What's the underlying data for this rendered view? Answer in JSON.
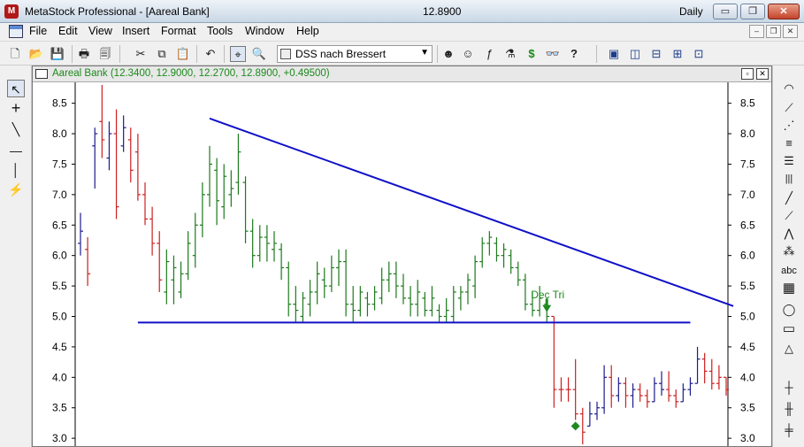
{
  "window": {
    "title": "MetaStock Professional - [Aareal Bank]",
    "last_price": "12.8900",
    "periodicity": "Daily",
    "min_glyph": "▭",
    "max_glyph": "❐",
    "close_glyph": "✕"
  },
  "menu": {
    "items": [
      "File",
      "Edit",
      "View",
      "Insert",
      "Format",
      "Tools",
      "Window",
      "Help"
    ],
    "mdi_min": "–",
    "mdi_restore": "❐",
    "mdi_close": "✕"
  },
  "toolbar": {
    "template_value": "DSS nach Bressert",
    "icons": [
      {
        "name": "new-icon",
        "glyph": "🗋"
      },
      {
        "name": "open-icon",
        "glyph": "📂"
      },
      {
        "name": "save-icon",
        "glyph": "💾"
      },
      {
        "name": "print-icon",
        "glyph": "🖶"
      },
      {
        "name": "print-preview-icon",
        "glyph": "🗐"
      },
      {
        "name": "cut-icon",
        "glyph": "✂"
      },
      {
        "name": "copy-icon",
        "glyph": "⧉"
      },
      {
        "name": "paste-icon",
        "glyph": "📋"
      },
      {
        "name": "undo-icon",
        "glyph": "↶"
      },
      {
        "name": "crosshair-icon",
        "glyph": "⌖"
      },
      {
        "name": "zoom-icon",
        "glyph": "🔍"
      },
      {
        "name": "expert-advisor-icon",
        "glyph": "☻"
      },
      {
        "name": "explorer-icon",
        "glyph": "☺"
      },
      {
        "name": "indicator-builder-icon",
        "glyph": "ƒ"
      },
      {
        "name": "system-tester-icon",
        "glyph": "⚗"
      },
      {
        "name": "dollar-icon",
        "glyph": "$"
      },
      {
        "name": "binoculars-icon",
        "glyph": "👓"
      },
      {
        "name": "help-pointer-icon",
        "glyph": "?"
      },
      {
        "name": "cascade-icon",
        "glyph": "▣"
      },
      {
        "name": "tile-vertical-icon",
        "glyph": "◫"
      },
      {
        "name": "tile-horizontal-icon",
        "glyph": "⊟"
      },
      {
        "name": "tile-grid-icon",
        "glyph": "⊞"
      },
      {
        "name": "arrange-icon",
        "glyph": "⊡"
      }
    ]
  },
  "left_tools": [
    {
      "name": "pointer-tool-icon",
      "glyph": "↖"
    },
    {
      "name": "crosshair-tool-icon",
      "glyph": "+"
    },
    {
      "name": "trendline-tool-icon",
      "glyph": "╲"
    },
    {
      "name": "horizontal-line-tool-icon",
      "glyph": "—"
    },
    {
      "name": "vertical-line-tool-icon",
      "glyph": "│"
    },
    {
      "name": "cycle-line-tool-icon",
      "glyph": "⚡"
    }
  ],
  "right_tools": [
    {
      "name": "arc-tool-icon",
      "glyph": "◠"
    },
    {
      "name": "fan-tool-icon",
      "glyph": "⟋"
    },
    {
      "name": "speed-lines-tool-icon",
      "glyph": "⋰"
    },
    {
      "name": "retracement-tool-icon",
      "glyph": "≡"
    },
    {
      "name": "fib-levels-tool-icon",
      "glyph": "☰"
    },
    {
      "name": "time-zones-tool-icon",
      "glyph": "|||"
    },
    {
      "name": "line-tool-icon",
      "glyph": "╱"
    },
    {
      "name": "gann-fan-tool-icon",
      "glyph": "⟋"
    },
    {
      "name": "andrews-tool-icon",
      "glyph": "⋀"
    },
    {
      "name": "pattern-tool-icon",
      "glyph": "⁂"
    },
    {
      "name": "text-tool-icon",
      "glyph": "abc"
    },
    {
      "name": "grid-tool-icon",
      "glyph": "▦"
    },
    {
      "name": "ellipse-tool-icon",
      "glyph": "◯"
    },
    {
      "name": "rectangle-tool-icon",
      "glyph": "▭"
    },
    {
      "name": "triangle-tool-icon",
      "glyph": "△"
    },
    {
      "name": "bars-tool-icon",
      "glyph": "┼"
    },
    {
      "name": "bars2-tool-icon",
      "glyph": "╫"
    },
    {
      "name": "bars3-tool-icon",
      "glyph": "╪"
    }
  ],
  "chart": {
    "window_title": "Aareal Bank (12.3400, 12.9000, 12.2700, 12.8900, +0.49500)",
    "minimize_glyph": "▫",
    "close_glyph": "✕",
    "colors": {
      "up": "#1c7a1c",
      "down": "#cc1f1f",
      "neutral": "#1c1c8c",
      "trend": "#1010c8",
      "signal": "#1c8a1c"
    }
  },
  "chart_data": {
    "type": "ohlc_bar",
    "ylim": [
      2.9,
      8.8
    ],
    "y_ticks": [
      3.0,
      3.5,
      4.0,
      4.5,
      5.0,
      5.5,
      6.0,
      6.5,
      7.0,
      7.5,
      8.0,
      8.5
    ],
    "grid": false,
    "bars": [
      {
        "h": 6.7,
        "l": 6.0,
        "o": 6.2,
        "c": 6.4,
        "col": "neutral"
      },
      {
        "h": 6.3,
        "l": 5.5,
        "o": 6.1,
        "c": 5.7,
        "col": "down"
      },
      {
        "h": 8.1,
        "l": 7.1,
        "o": 7.8,
        "c": 8.0,
        "col": "neutral"
      },
      {
        "h": 8.8,
        "l": 7.6,
        "o": 8.2,
        "c": 7.9,
        "col": "down"
      },
      {
        "h": 8.2,
        "l": 7.4,
        "o": 7.6,
        "c": 8.0,
        "col": "neutral"
      },
      {
        "h": 8.4,
        "l": 6.6,
        "o": 8.0,
        "c": 6.8,
        "col": "down"
      },
      {
        "h": 8.3,
        "l": 7.7,
        "o": 7.8,
        "c": 8.1,
        "col": "neutral"
      },
      {
        "h": 8.1,
        "l": 7.2,
        "o": 7.9,
        "c": 7.4,
        "col": "down"
      },
      {
        "h": 8.0,
        "l": 6.9,
        "o": 7.7,
        "c": 7.0,
        "col": "down"
      },
      {
        "h": 7.2,
        "l": 6.5,
        "o": 7.0,
        "c": 6.6,
        "col": "down"
      },
      {
        "h": 6.8,
        "l": 6.0,
        "o": 6.6,
        "c": 6.2,
        "col": "down"
      },
      {
        "h": 6.4,
        "l": 5.4,
        "o": 6.2,
        "c": 5.6,
        "col": "down"
      },
      {
        "h": 6.1,
        "l": 5.2,
        "o": 5.4,
        "c": 5.9,
        "col": "up"
      },
      {
        "h": 6.0,
        "l": 5.2,
        "o": 5.6,
        "c": 5.8,
        "col": "up"
      },
      {
        "h": 5.9,
        "l": 5.3,
        "o": 5.4,
        "c": 5.7,
        "col": "up"
      },
      {
        "h": 6.4,
        "l": 5.6,
        "o": 5.7,
        "c": 6.2,
        "col": "up"
      },
      {
        "h": 6.7,
        "l": 5.8,
        "o": 6.0,
        "c": 6.5,
        "col": "up"
      },
      {
        "h": 7.2,
        "l": 6.3,
        "o": 6.5,
        "c": 7.0,
        "col": "up"
      },
      {
        "h": 7.8,
        "l": 6.8,
        "o": 7.0,
        "c": 7.5,
        "col": "up"
      },
      {
        "h": 7.6,
        "l": 6.5,
        "o": 7.4,
        "c": 6.9,
        "col": "up"
      },
      {
        "h": 7.5,
        "l": 6.6,
        "o": 6.8,
        "c": 7.3,
        "col": "up"
      },
      {
        "h": 7.4,
        "l": 6.8,
        "o": 7.0,
        "c": 7.1,
        "col": "up"
      },
      {
        "h": 8.0,
        "l": 7.0,
        "o": 7.2,
        "c": 7.7,
        "col": "up"
      },
      {
        "h": 7.3,
        "l": 6.2,
        "o": 7.2,
        "c": 6.4,
        "col": "up"
      },
      {
        "h": 6.6,
        "l": 5.8,
        "o": 6.4,
        "c": 6.0,
        "col": "up"
      },
      {
        "h": 6.5,
        "l": 5.9,
        "o": 6.0,
        "c": 6.3,
        "col": "up"
      },
      {
        "h": 6.5,
        "l": 5.9,
        "o": 6.3,
        "c": 6.2,
        "col": "up"
      },
      {
        "h": 6.4,
        "l": 5.9,
        "o": 6.1,
        "c": 6.2,
        "col": "up"
      },
      {
        "h": 6.2,
        "l": 5.6,
        "o": 6.1,
        "c": 5.8,
        "col": "up"
      },
      {
        "h": 5.9,
        "l": 5.0,
        "o": 5.8,
        "c": 5.2,
        "col": "up"
      },
      {
        "h": 5.5,
        "l": 4.9,
        "o": 5.2,
        "c": 5.1,
        "col": "up"
      },
      {
        "h": 5.4,
        "l": 4.9,
        "o": 5.0,
        "c": 5.3,
        "col": "up"
      },
      {
        "h": 5.6,
        "l": 5.0,
        "o": 5.2,
        "c": 5.4,
        "col": "up"
      },
      {
        "h": 5.9,
        "l": 5.2,
        "o": 5.4,
        "c": 5.7,
        "col": "up"
      },
      {
        "h": 5.8,
        "l": 5.3,
        "o": 5.6,
        "c": 5.5,
        "col": "up"
      },
      {
        "h": 6.0,
        "l": 5.4,
        "o": 5.5,
        "c": 5.8,
        "col": "up"
      },
      {
        "h": 6.1,
        "l": 5.5,
        "o": 5.8,
        "c": 5.9,
        "col": "up"
      },
      {
        "h": 6.1,
        "l": 5.0,
        "o": 5.9,
        "c": 5.2,
        "col": "up"
      },
      {
        "h": 5.5,
        "l": 4.9,
        "o": 5.2,
        "c": 5.1,
        "col": "up"
      },
      {
        "h": 5.5,
        "l": 5.0,
        "o": 5.1,
        "c": 5.4,
        "col": "up"
      },
      {
        "h": 5.4,
        "l": 5.0,
        "o": 5.3,
        "c": 5.2,
        "col": "up"
      },
      {
        "h": 5.5,
        "l": 5.1,
        "o": 5.2,
        "c": 5.4,
        "col": "up"
      },
      {
        "h": 5.8,
        "l": 5.2,
        "o": 5.3,
        "c": 5.6,
        "col": "up"
      },
      {
        "h": 5.9,
        "l": 5.4,
        "o": 5.6,
        "c": 5.7,
        "col": "up"
      },
      {
        "h": 5.9,
        "l": 5.3,
        "o": 5.7,
        "c": 5.5,
        "col": "up"
      },
      {
        "h": 5.7,
        "l": 5.2,
        "o": 5.5,
        "c": 5.3,
        "col": "up"
      },
      {
        "h": 5.5,
        "l": 5.0,
        "o": 5.3,
        "c": 5.2,
        "col": "up"
      },
      {
        "h": 5.6,
        "l": 5.0,
        "o": 5.2,
        "c": 5.4,
        "col": "up"
      },
      {
        "h": 5.4,
        "l": 5.0,
        "o": 5.3,
        "c": 5.1,
        "col": "up"
      },
      {
        "h": 5.5,
        "l": 5.0,
        "o": 5.1,
        "c": 5.3,
        "col": "up"
      },
      {
        "h": 5.2,
        "l": 4.9,
        "o": 5.1,
        "c": 5.0,
        "col": "up"
      },
      {
        "h": 5.3,
        "l": 4.9,
        "o": 5.0,
        "c": 5.1,
        "col": "up"
      },
      {
        "h": 5.5,
        "l": 4.9,
        "o": 5.0,
        "c": 5.4,
        "col": "up"
      },
      {
        "h": 5.5,
        "l": 5.1,
        "o": 5.3,
        "c": 5.4,
        "col": "up"
      },
      {
        "h": 5.7,
        "l": 5.2,
        "o": 5.4,
        "c": 5.6,
        "col": "up"
      },
      {
        "h": 6.0,
        "l": 5.3,
        "o": 5.5,
        "c": 5.9,
        "col": "up"
      },
      {
        "h": 6.3,
        "l": 5.8,
        "o": 5.9,
        "c": 6.2,
        "col": "up"
      },
      {
        "h": 6.4,
        "l": 6.0,
        "o": 6.2,
        "c": 6.3,
        "col": "up"
      },
      {
        "h": 6.3,
        "l": 5.9,
        "o": 6.2,
        "c": 6.0,
        "col": "up"
      },
      {
        "h": 6.2,
        "l": 5.8,
        "o": 6.0,
        "c": 6.1,
        "col": "up"
      },
      {
        "h": 6.1,
        "l": 5.7,
        "o": 6.0,
        "c": 5.8,
        "col": "up"
      },
      {
        "h": 5.9,
        "l": 5.5,
        "o": 5.8,
        "c": 5.6,
        "col": "up"
      },
      {
        "h": 5.7,
        "l": 5.1,
        "o": 5.6,
        "c": 5.2,
        "col": "up"
      },
      {
        "h": 5.4,
        "l": 5.0,
        "o": 5.2,
        "c": 5.1,
        "col": "up"
      },
      {
        "h": 5.5,
        "l": 5.0,
        "o": 5.1,
        "c": 5.3,
        "col": "up"
      },
      {
        "h": 5.3,
        "l": 4.9,
        "o": 5.2,
        "c": 5.0,
        "col": "up"
      },
      {
        "h": 5.0,
        "l": 3.5,
        "o": 5.0,
        "c": 3.8,
        "col": "down"
      },
      {
        "h": 4.0,
        "l": 3.6,
        "o": 3.8,
        "c": 3.8,
        "col": "down"
      },
      {
        "h": 4.0,
        "l": 3.6,
        "o": 3.8,
        "c": 3.8,
        "col": "down"
      },
      {
        "h": 4.3,
        "l": 3.3,
        "o": 3.8,
        "c": 3.4,
        "col": "down"
      },
      {
        "h": 3.5,
        "l": 2.9,
        "o": 3.4,
        "c": 3.1,
        "col": "down"
      },
      {
        "h": 3.6,
        "l": 3.2,
        "o": 3.2,
        "c": 3.4,
        "col": "neutral"
      },
      {
        "h": 3.6,
        "l": 3.3,
        "o": 3.4,
        "c": 3.5,
        "col": "neutral"
      },
      {
        "h": 4.2,
        "l": 3.4,
        "o": 3.5,
        "c": 4.0,
        "col": "neutral"
      },
      {
        "h": 4.2,
        "l": 3.5,
        "o": 4.0,
        "c": 3.7,
        "col": "down"
      },
      {
        "h": 4.0,
        "l": 3.6,
        "o": 3.7,
        "c": 3.9,
        "col": "neutral"
      },
      {
        "h": 4.0,
        "l": 3.5,
        "o": 3.9,
        "c": 3.7,
        "col": "down"
      },
      {
        "h": 3.9,
        "l": 3.5,
        "o": 3.7,
        "c": 3.8,
        "col": "neutral"
      },
      {
        "h": 3.9,
        "l": 3.6,
        "o": 3.8,
        "c": 3.7,
        "col": "down"
      },
      {
        "h": 3.8,
        "l": 3.5,
        "o": 3.7,
        "c": 3.6,
        "col": "down"
      },
      {
        "h": 4.0,
        "l": 3.6,
        "o": 3.6,
        "c": 3.9,
        "col": "neutral"
      },
      {
        "h": 4.1,
        "l": 3.7,
        "o": 3.9,
        "c": 3.8,
        "col": "neutral"
      },
      {
        "h": 4.1,
        "l": 3.6,
        "o": 3.8,
        "c": 3.7,
        "col": "down"
      },
      {
        "h": 3.8,
        "l": 3.5,
        "o": 3.7,
        "c": 3.6,
        "col": "down"
      },
      {
        "h": 3.9,
        "l": 3.6,
        "o": 3.6,
        "c": 3.8,
        "col": "neutral"
      },
      {
        "h": 4.0,
        "l": 3.7,
        "o": 3.8,
        "c": 3.9,
        "col": "neutral"
      },
      {
        "h": 4.5,
        "l": 3.9,
        "o": 3.9,
        "c": 4.3,
        "col": "neutral"
      },
      {
        "h": 4.4,
        "l": 3.9,
        "o": 4.3,
        "c": 4.1,
        "col": "down"
      },
      {
        "h": 4.3,
        "l": 3.8,
        "o": 4.1,
        "c": 3.9,
        "col": "down"
      },
      {
        "h": 4.2,
        "l": 3.8,
        "o": 3.9,
        "c": 4.0,
        "col": "down"
      },
      {
        "h": 4.0,
        "l": 3.7,
        "o": 4.0,
        "c": 3.8,
        "col": "down"
      }
    ],
    "trendlines": [
      {
        "from": [
          0.0,
          8.25
        ],
        "to": [
          1.0,
          5.17
        ],
        "x_start_index": 18,
        "x_end_index": 91
      },
      {
        "from": [
          0.0,
          4.9
        ],
        "to": [
          1.0,
          4.9
        ],
        "x_start_index": 8,
        "x_end_index": 85
      }
    ],
    "annotations": [
      {
        "text": "Dec Tri",
        "bar_index": 65,
        "price": 5.3,
        "kind": "label"
      },
      {
        "bar_index": 65,
        "price": 5.1,
        "kind": "down-arrow"
      },
      {
        "bar_index": 69,
        "price": 3.2,
        "kind": "diamond"
      }
    ]
  }
}
